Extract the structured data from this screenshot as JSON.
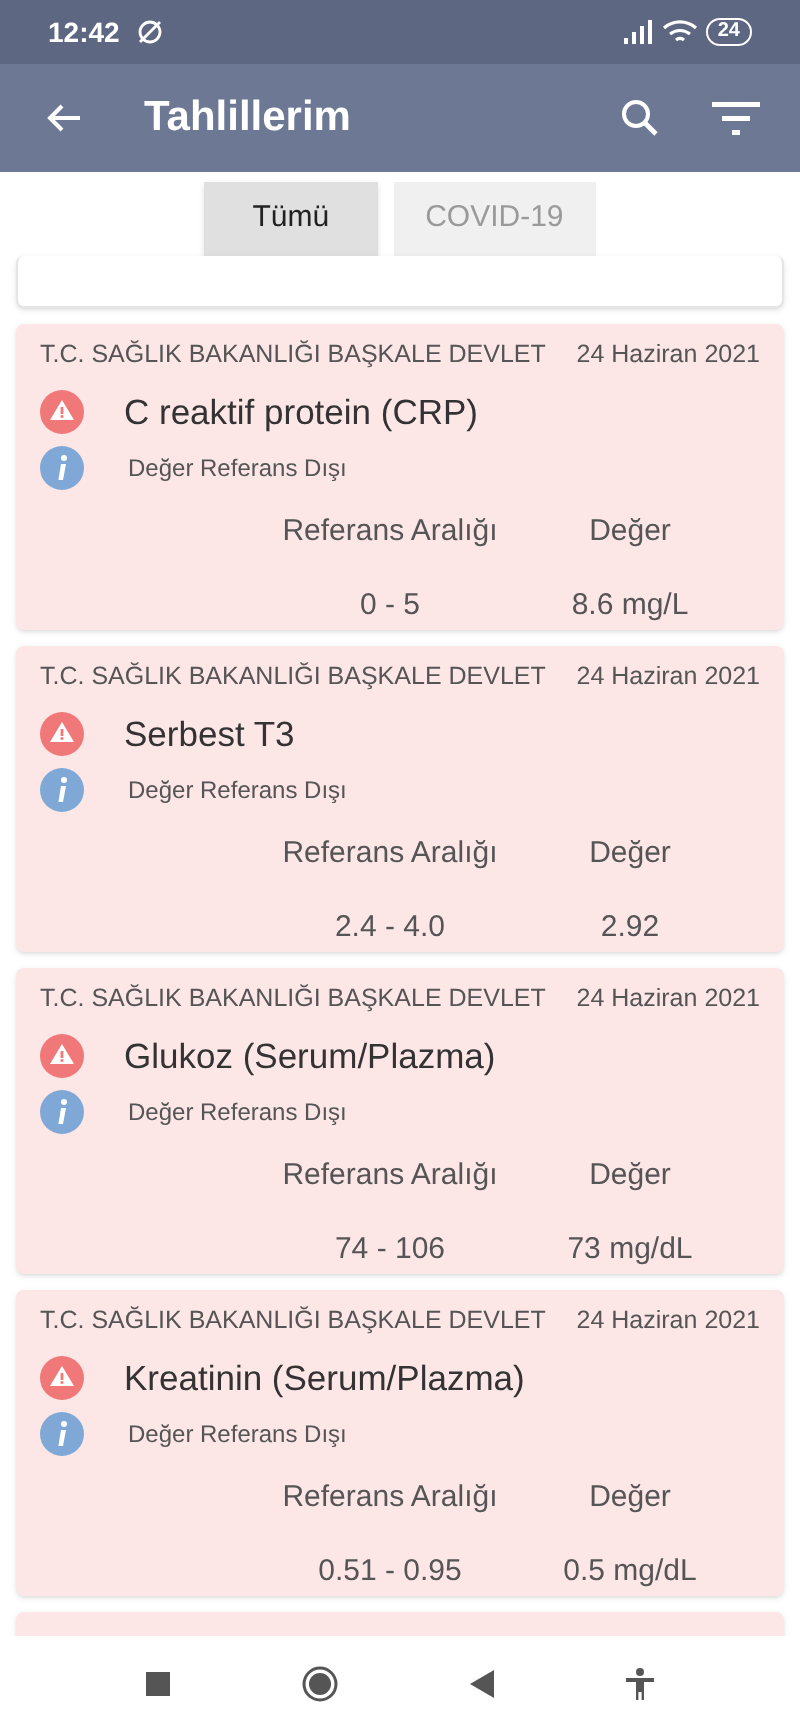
{
  "status_bar": {
    "time": "12:42",
    "battery": "24"
  },
  "app_bar": {
    "title": "Tahlillerim"
  },
  "tabs": [
    {
      "label": "Tümü",
      "selected": true
    },
    {
      "label": "COVID-19",
      "selected": false
    }
  ],
  "results": [
    {
      "institution": "T.C. SAĞLIK BAKANLIĞI BAŞKALE DEVLET",
      "date": "24 Haziran 2021",
      "test": "C reaktif protein (CRP)",
      "status": "Değer Referans Dışı",
      "out_of_range": true,
      "range_label": "Referans Aralığı",
      "value_label": "Değer",
      "range": "0 - 5",
      "value": "8.6 mg/L"
    },
    {
      "institution": "T.C. SAĞLIK BAKANLIĞI BAŞKALE DEVLET",
      "date": "24 Haziran 2021",
      "test": "Serbest T3",
      "status": "Değer Referans Dışı",
      "out_of_range": true,
      "range_label": "Referans Aralığı",
      "value_label": "Değer",
      "range": "2.4 - 4.0",
      "value": "2.92"
    },
    {
      "institution": "T.C. SAĞLIK BAKANLIĞI BAŞKALE DEVLET",
      "date": "24 Haziran 2021",
      "test": "Glukoz (Serum/Plazma)",
      "status": "Değer Referans Dışı",
      "out_of_range": true,
      "range_label": "Referans Aralığı",
      "value_label": "Değer",
      "range": "74 - 106",
      "value": "73 mg/dL"
    },
    {
      "institution": "T.C. SAĞLIK BAKANLIĞI BAŞKALE DEVLET",
      "date": "24 Haziran 2021",
      "test": "Kreatinin (Serum/Plazma)",
      "status": "Değer Referans Dışı",
      "out_of_range": true,
      "range_label": "Referans Aralığı",
      "value_label": "Değer",
      "range": "0.51 - 0.95",
      "value": "0.5 mg/dL"
    }
  ]
}
